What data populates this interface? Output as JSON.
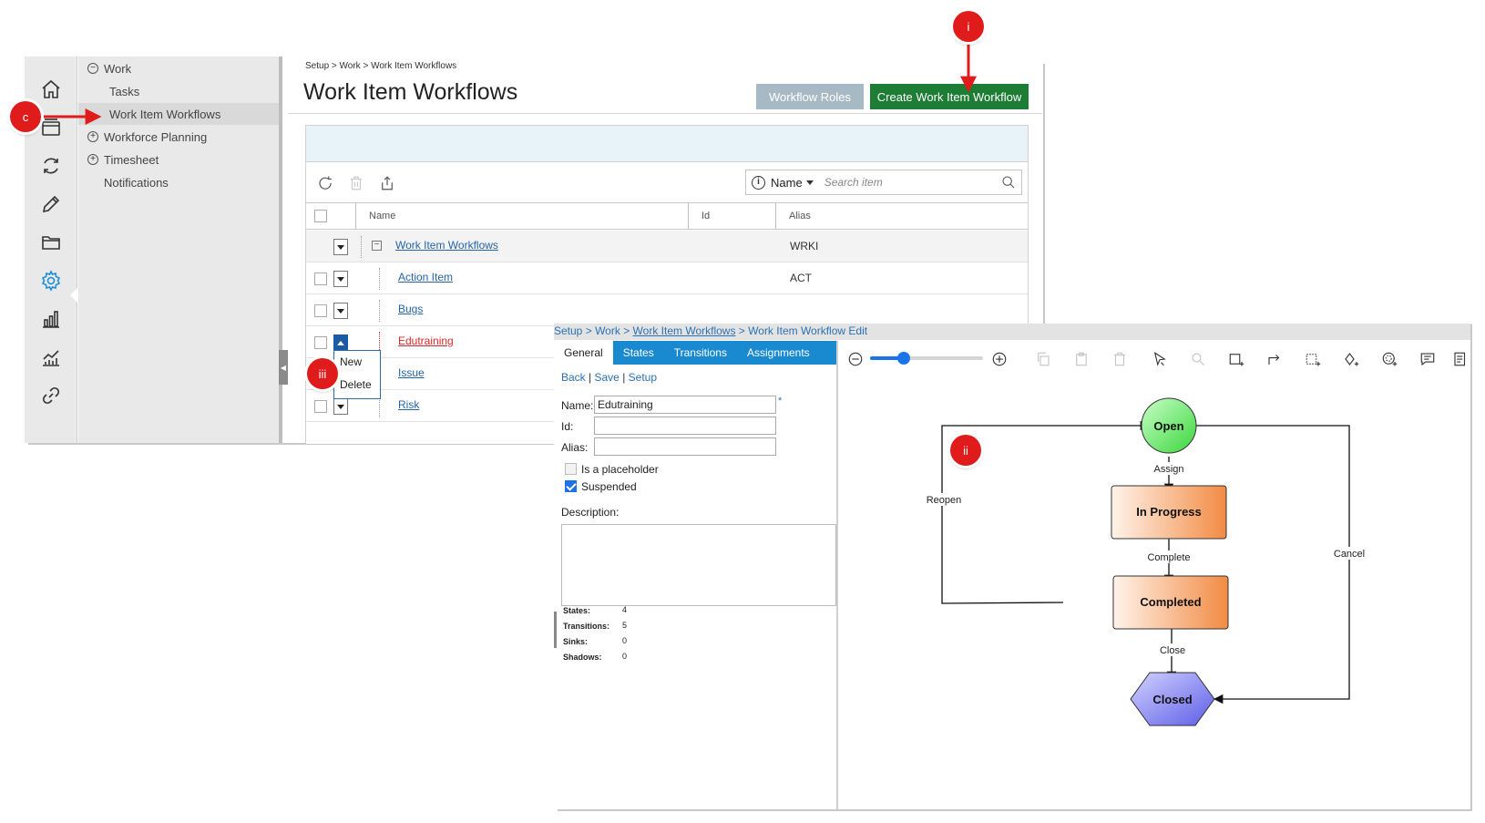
{
  "annotations": {
    "c": "c",
    "i": "i",
    "ii": "ii",
    "iii": "iii"
  },
  "sidebar": {
    "icons": [
      "home-icon",
      "layers-icon",
      "refresh-cycle-icon",
      "pencil-icon",
      "folder-icon",
      "gear-icon",
      "bar-chart-icon",
      "line-chart-icon",
      "link-icon"
    ],
    "active": "gear-icon"
  },
  "nav": {
    "items": [
      {
        "label": "Work",
        "prefix": "⊖"
      },
      {
        "label": "Tasks"
      },
      {
        "label": "Work Item Workflows"
      },
      {
        "label": "Workforce Planning",
        "prefix": "⊕"
      },
      {
        "label": "Timesheet",
        "prefix": "⊕"
      },
      {
        "label": "Notifications"
      }
    ],
    "selected": "Work Item Workflows"
  },
  "page1": {
    "breadcrumb": "Setup > Work > Work Item Workflows",
    "title": "Work Item Workflows",
    "btn_roles": "Workflow Roles",
    "btn_create": "Create Work Item Workflow"
  },
  "search": {
    "field": "Name",
    "placeholder": "Search item"
  },
  "grid": {
    "columns": [
      "Name",
      "Id",
      "Alias"
    ],
    "rows": [
      {
        "name": "Work Item Workflows",
        "alias": "WRKI",
        "parent": true
      },
      {
        "name": "Action Item",
        "alias": "ACT"
      },
      {
        "name": "Bugs",
        "alias": ""
      },
      {
        "name": "Edutraining",
        "alias": "",
        "highlight": "#d92a2a"
      },
      {
        "name": "Issue",
        "alias": ""
      },
      {
        "name": "Risk",
        "alias": ""
      }
    ]
  },
  "context_menu": [
    "New",
    "Delete"
  ],
  "editor": {
    "breadcrumb": {
      "setup": "Setup",
      "work": "Work",
      "wiw": "Work Item Workflows",
      "current": "Work Item Workflow Edit",
      "sep": ">"
    },
    "tabs": [
      "General",
      "States",
      "Transitions",
      "Assignments"
    ],
    "actions": {
      "back": "Back",
      "save": "Save",
      "setup": "Setup",
      "sep": "|"
    },
    "fields": {
      "name_label": "Name:",
      "name_value": "Edutraining",
      "id_label": "Id:",
      "id_value": "",
      "alias_label": "Alias:",
      "alias_value": "",
      "required_mark": "*"
    },
    "placeholder_label": "Is a placeholder",
    "placeholder_checked": false,
    "suspended_label": "Suspended",
    "suspended_checked": true,
    "description_label": "Description:",
    "stats": [
      {
        "label": "States:",
        "value": "4"
      },
      {
        "label": "Transitions:",
        "value": "5"
      },
      {
        "label": "Sinks:",
        "value": "0"
      },
      {
        "label": "Shadows:",
        "value": "0"
      }
    ],
    "zoom_level": 0.3
  },
  "diagram": {
    "states": {
      "open": "Open",
      "in_progress": "In Progress",
      "completed": "Completed",
      "closed": "Closed"
    },
    "transitions": {
      "assign": "Assign",
      "complete": "Complete",
      "close": "Close",
      "reopen": "Reopen",
      "cancel": "Cancel"
    },
    "colors": {
      "open": "#3bd63b",
      "progress": "#f28b44",
      "closed": "#5d5de8",
      "annotation": "#e01b1b"
    }
  }
}
